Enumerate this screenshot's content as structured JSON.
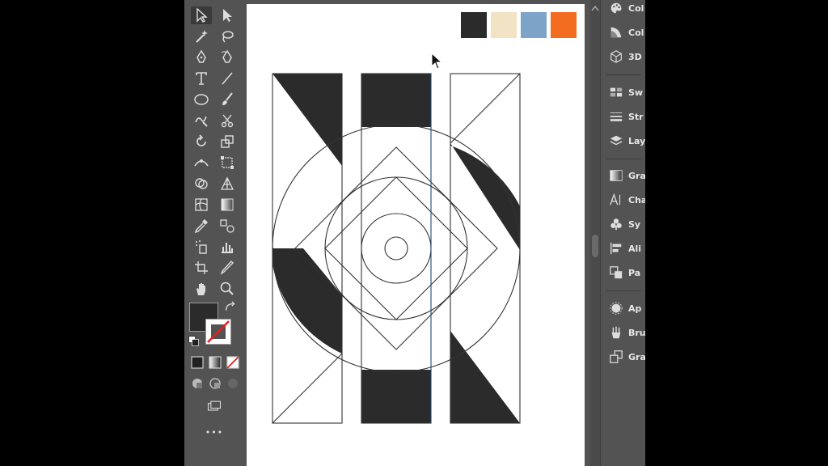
{
  "panel": {
    "items": [
      {
        "icon": "color-guide-icon",
        "label": "Col"
      },
      {
        "icon": "color-icon",
        "label": "Col"
      },
      {
        "icon": "3d-cube-icon",
        "label": "3D"
      },
      {
        "icon": "swatches-icon",
        "label": "Sw"
      },
      {
        "icon": "stroke-icon",
        "label": "Str"
      },
      {
        "icon": "layers-icon",
        "label": "Lay"
      },
      {
        "icon": "gradient-icon",
        "label": "Gra"
      },
      {
        "icon": "character-icon",
        "label": "Cha"
      },
      {
        "icon": "symbols-icon",
        "label": "Sy"
      },
      {
        "icon": "align-icon",
        "label": "Ali"
      },
      {
        "icon": "pathfinder-icon",
        "label": "Pa"
      },
      {
        "icon": "appearance-icon",
        "label": "Ap"
      },
      {
        "icon": "brushes-icon",
        "label": "Bru"
      },
      {
        "icon": "graphic-styles-icon",
        "label": "Gra"
      }
    ]
  },
  "colors": {
    "palette": [
      "#2b2b2b",
      "#f1e3c3",
      "#7ea3c8",
      "#f26d1f"
    ],
    "ui_bg": "#535353",
    "fill_swatch": "#2b2b2b"
  },
  "toolbar": {
    "more_label": "•••"
  }
}
